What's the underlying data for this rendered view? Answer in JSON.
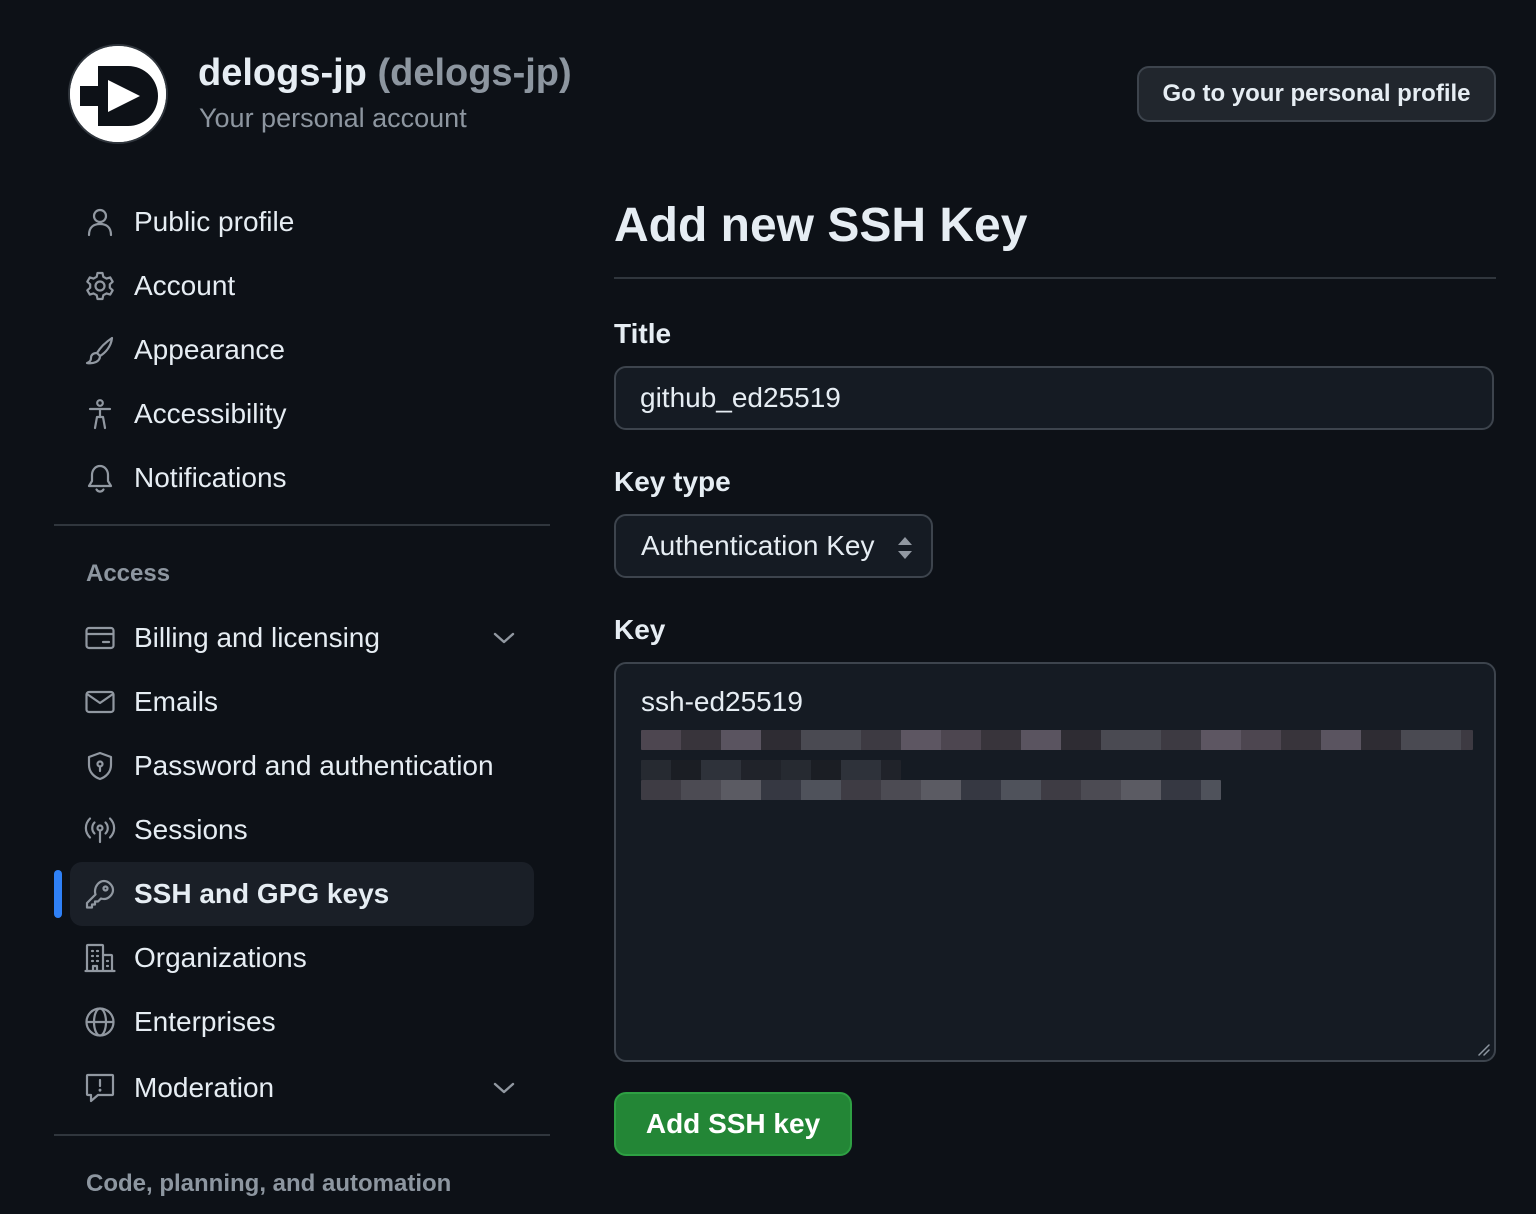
{
  "header": {
    "display_name": "delogs-jp",
    "login": "(delogs-jp)",
    "subtitle": "Your personal account",
    "profile_button_label": "Go to your personal profile",
    "avatar_icon": "play-d-logo"
  },
  "sidebar": {
    "items": [
      {
        "label": "Public profile",
        "icon": "person-icon"
      },
      {
        "label": "Account",
        "icon": "gear-icon"
      },
      {
        "label": "Appearance",
        "icon": "paintbrush-icon"
      },
      {
        "label": "Accessibility",
        "icon": "accessibility-icon"
      },
      {
        "label": "Notifications",
        "icon": "bell-icon"
      }
    ],
    "access_heading": "Access",
    "access_items": [
      {
        "label": "Billing and licensing",
        "icon": "credit-card-icon",
        "expandable": true
      },
      {
        "label": "Emails",
        "icon": "mail-icon"
      },
      {
        "label": "Password and authentication",
        "icon": "shield-lock-icon"
      },
      {
        "label": "Sessions",
        "icon": "broadcast-icon"
      },
      {
        "label": "SSH and GPG keys",
        "icon": "key-icon",
        "active": true
      },
      {
        "label": "Organizations",
        "icon": "organization-icon"
      },
      {
        "label": "Enterprises",
        "icon": "globe-icon"
      },
      {
        "label": "Moderation",
        "icon": "report-icon",
        "expandable": true
      }
    ],
    "code_heading": "Code, planning, and automation"
  },
  "main": {
    "title": "Add new SSH Key",
    "title_label": "Title",
    "title_value": "github_ed25519",
    "key_type_label": "Key type",
    "key_type_value": "Authentication Key",
    "key_label": "Key",
    "key_value": "ssh-ed25519",
    "submit_label": "Add SSH key"
  },
  "colors": {
    "background": "#0d1117",
    "accent": "#2f81f7",
    "primary_button": "#238636"
  }
}
